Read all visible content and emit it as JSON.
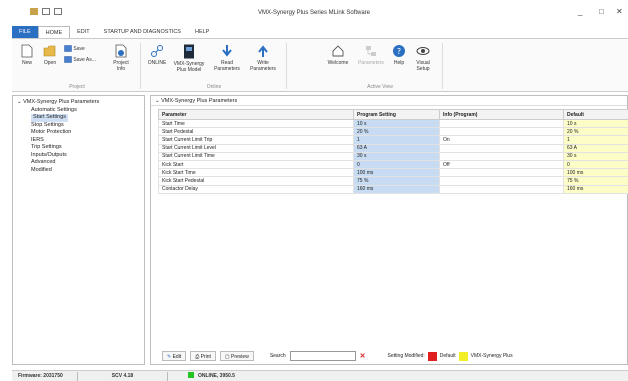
{
  "window": {
    "title": "VMX-Synergy Plus Series MLink Software",
    "minimize": "_",
    "maximize": "□",
    "close": "✕"
  },
  "menu": [
    "FILE",
    "HOME",
    "EDIT",
    "STARTUP AND DIAGNOSTICS",
    "HELP"
  ],
  "ribbon": {
    "project": {
      "new": "New",
      "open": "Open",
      "save": "Save",
      "save_as": "Save As...",
      "project_info": "Project Info",
      "group_label": "Project"
    },
    "online": {
      "online": "ONLINE",
      "model": "VMX-Synergy Plus Model",
      "read": "Read Parameters",
      "write": "Write Parameters",
      "group_label": "Online"
    },
    "active_view": {
      "welcome": "Welcome",
      "parameters": "Parameters",
      "help": "Help",
      "visual_setup": "Visual Setup",
      "group_label": "Active View"
    }
  },
  "tree": {
    "root": "VMX-Synergy Plus Parameters",
    "items": [
      "Automatic Settings",
      "Start Settings",
      "Stop Settings",
      "Motor Protection",
      "IERS",
      "Trip Settings",
      "Inputs/Outputs",
      "Advanced",
      "Modified"
    ],
    "selected": "Start Settings"
  },
  "panel": {
    "title": "VMX-Synergy Plus Parameters",
    "columns": [
      "Parameter",
      "Program Setting",
      "Info (Program)",
      "Default"
    ],
    "rows": [
      [
        "Start Time",
        "10 s",
        "",
        "10 s"
      ],
      [
        "Start Pedestal",
        "20 %",
        "",
        "20 %"
      ],
      [
        "Start Current Limit Trip",
        "1",
        "On",
        "1"
      ],
      [
        "Start Current Limit Level",
        "63 A",
        "",
        "63 A"
      ],
      [
        "Start Current Limit Time",
        "30 s",
        "",
        "30 s"
      ],
      [
        "Kick Start",
        "0",
        "Off",
        "0"
      ],
      [
        "Kick Start Time",
        "100 ms",
        "",
        "100 ms"
      ],
      [
        "Kick Start Pedestal",
        "75 %",
        "",
        "75 %"
      ],
      [
        "Contactor Delay",
        "160 ms",
        "",
        "160 ms"
      ]
    ]
  },
  "bottombar": {
    "edit": "Edit",
    "print": "Print",
    "preview": "Preview",
    "search_label": "Search",
    "search_value": "",
    "clear": "✕",
    "legend_label": "Setting Modified:",
    "legend_default": "Default",
    "legend_vmx": "VMX-Synergy Plus",
    "colors": {
      "modified": "#e02020",
      "vmx": "#f2ee2a"
    }
  },
  "status": {
    "firmware": "Firmware: 2031750",
    "version": "SCV 4.18",
    "online": "ONLINE, 3950.5"
  }
}
